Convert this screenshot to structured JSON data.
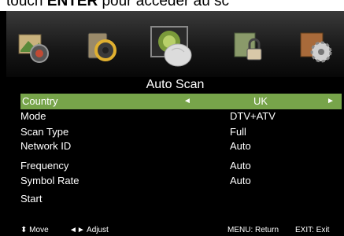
{
  "doc": {
    "pre": "touch",
    "key": "ENTER",
    "post": " pour accéder au sc"
  },
  "icons": [
    "picture-icon",
    "sound-icon",
    "channel-icon",
    "lock-icon",
    "setup-icon"
  ],
  "menu": {
    "title": "Auto Scan",
    "rows": [
      {
        "label": "Country",
        "value": "UK",
        "selected": true
      },
      {
        "label": "Mode",
        "value": "DTV+ATV"
      },
      {
        "label": "Scan Type",
        "value": "Full"
      },
      {
        "label": "Network ID",
        "value": "Auto"
      },
      {
        "label": "Frequency",
        "value": "Auto"
      },
      {
        "label": "Symbol Rate",
        "value": "Auto"
      },
      {
        "label": "Start",
        "value": ""
      }
    ],
    "arrows": {
      "left": "◄",
      "right": "►"
    }
  },
  "hints": {
    "move_symbol": "⬍",
    "move": "Move",
    "adjust_symbol": "◄►",
    "adjust": "Adjust",
    "menu_return": "MENU: Return",
    "exit": "EXIT: Exit"
  },
  "colors": {
    "selected_row": "#77a44a",
    "background": "#000000"
  }
}
